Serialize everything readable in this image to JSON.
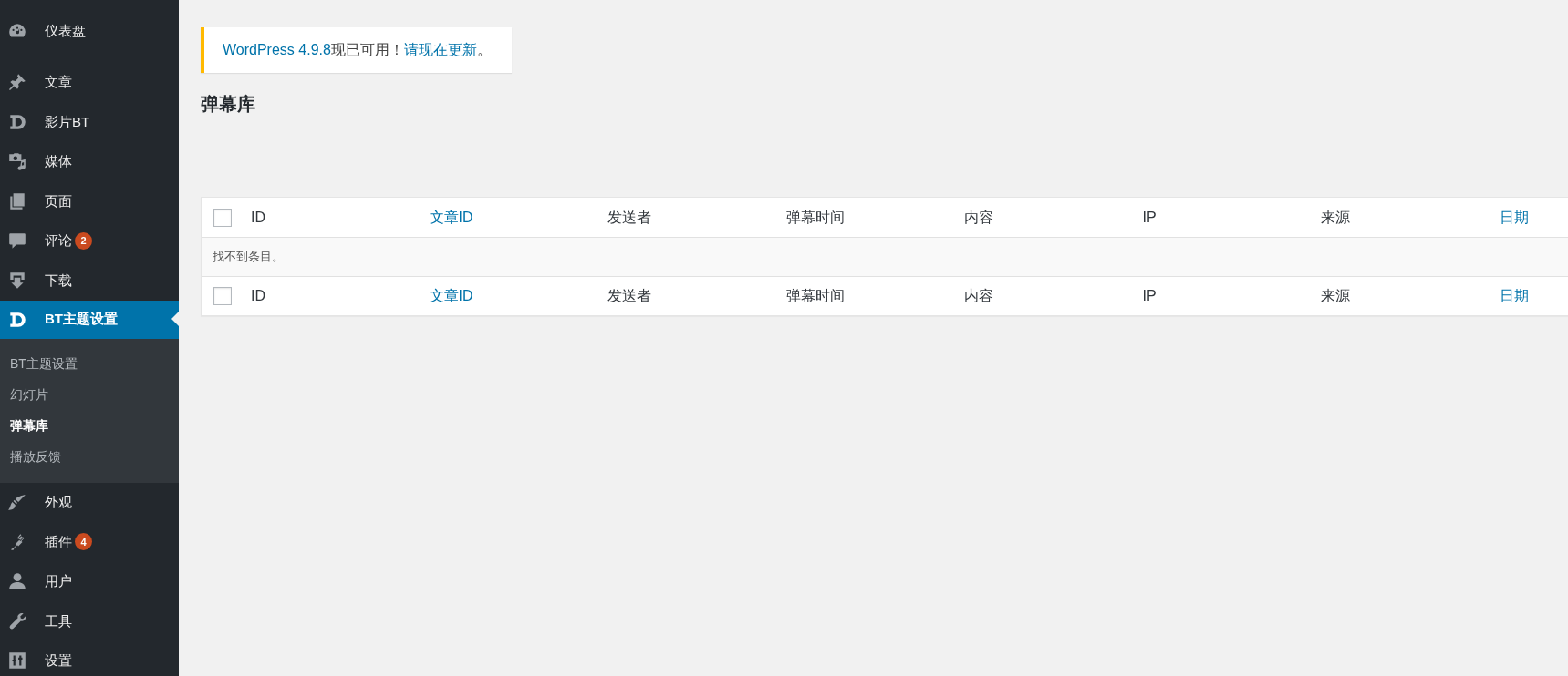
{
  "sidebar": {
    "items": [
      {
        "label": "仪表盘",
        "selected": false
      },
      {
        "label": "文章",
        "selected": false
      },
      {
        "label": "影片BT",
        "selected": false
      },
      {
        "label": "媒体",
        "selected": false
      },
      {
        "label": "页面",
        "selected": false
      },
      {
        "label": "评论",
        "count": "2",
        "selected": false
      },
      {
        "label": "下载",
        "selected": false
      },
      {
        "label": "BT主题设置",
        "selected": true,
        "children": [
          {
            "label": "BT主题设置",
            "selected": false
          },
          {
            "label": "幻灯片",
            "selected": false
          },
          {
            "label": "弹幕库",
            "selected": true
          },
          {
            "label": "播放反馈",
            "selected": false
          }
        ]
      },
      {
        "label": "外观",
        "selected": false
      },
      {
        "label": "插件",
        "count": "4",
        "selected": false
      },
      {
        "label": "用户",
        "selected": false
      },
      {
        "label": "工具",
        "selected": false
      },
      {
        "label": "设置",
        "selected": false
      }
    ]
  },
  "notice": {
    "link": "WordPress 4.9.8",
    "text": "现已可用！",
    "action": "请现在更新",
    "end": "。"
  },
  "page_title": "弹幕库",
  "table": {
    "columns": [
      {
        "label": "ID",
        "sortable": false
      },
      {
        "label": "文章ID",
        "sortable": true
      },
      {
        "label": "发送者",
        "sortable": false
      },
      {
        "label": "弹幕时间",
        "sortable": false
      },
      {
        "label": "内容",
        "sortable": false
      },
      {
        "label": "IP",
        "sortable": false
      },
      {
        "label": "来源",
        "sortable": false
      },
      {
        "label": "日期",
        "sortable": true
      }
    ],
    "select_all_checked": false,
    "empty_message": "找不到条目。",
    "footer_select_all_checked": false,
    "footer_columns": [
      {
        "label": "ID",
        "sortable": false
      },
      {
        "label": "文章ID",
        "sortable": true
      },
      {
        "label": "发送者",
        "sortable": false
      },
      {
        "label": "弹幕时间",
        "sortable": false
      },
      {
        "label": "内容",
        "sortable": false
      },
      {
        "label": "IP",
        "sortable": false
      },
      {
        "label": "来源",
        "sortable": false
      },
      {
        "label": "日期",
        "sortable": true
      }
    ]
  }
}
